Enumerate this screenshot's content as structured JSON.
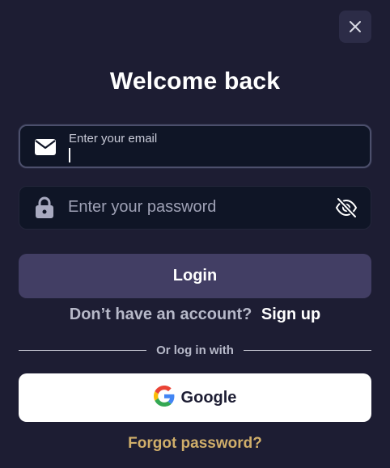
{
  "dialog": {
    "title": "Welcome back",
    "close_icon": "close-icon"
  },
  "email": {
    "label": "Enter your email",
    "value": "",
    "icon": "envelope-icon"
  },
  "password": {
    "placeholder": "Enter your password",
    "value": "",
    "icon": "lock-icon",
    "toggle_icon": "eye-slash-icon"
  },
  "login": {
    "label": "Login"
  },
  "signup": {
    "prompt": "Don’t have an account?",
    "link": "Sign up"
  },
  "divider": {
    "text": "Or log in with"
  },
  "google": {
    "label": "Google",
    "icon": "google-logo-icon"
  },
  "forgot": {
    "label": "Forgot password?"
  },
  "colors": {
    "background": "#1d1d33",
    "input_background": "#0f1526",
    "login_button": "#423e64",
    "forgot_link": "#d0ae6a"
  }
}
